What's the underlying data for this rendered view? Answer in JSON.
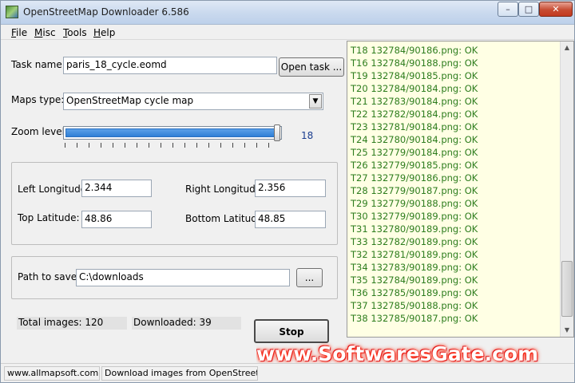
{
  "window": {
    "title": "OpenStreetMap Downloader 6.586",
    "minimize_glyph": "–",
    "maximize_glyph": "□",
    "close_glyph": "✕"
  },
  "menu": {
    "items": [
      {
        "key": "F",
        "rest": "ile"
      },
      {
        "key": "M",
        "rest": "isc"
      },
      {
        "key": "T",
        "rest": "ools"
      },
      {
        "key": "H",
        "rest": "elp"
      }
    ]
  },
  "task": {
    "label": "Task name:",
    "value": "paris_18_cycle.eomd",
    "open_button": "Open task ..."
  },
  "maps": {
    "label": "Maps type:",
    "value": "OpenStreetMap cycle map",
    "arrow_glyph": "▼"
  },
  "zoom": {
    "label": "Zoom level:",
    "value": "18",
    "level_fraction": 1.0
  },
  "coords": {
    "left_longitude_label": "Left Longitude:",
    "left_longitude": "2.344",
    "right_longitude_label": "Right Longitude:",
    "right_longitude": "2.356",
    "top_latitude_label": "Top Latitude:",
    "top_latitude": "48.86",
    "bottom_latitude_label": "Bottom Latitude:",
    "bottom_latitude": "48.85"
  },
  "path": {
    "label": "Path to save:",
    "value": "C:\\downloads",
    "browse_button": "..."
  },
  "progress": {
    "total_images": "Total images: 120",
    "downloaded": "Downloaded: 39",
    "stop_button": "Stop"
  },
  "log": {
    "lines": [
      "T18 132784/90186.png: OK",
      "T16 132784/90188.png: OK",
      "T19 132784/90185.png: OK",
      "T20 132784/90184.png: OK",
      "T21 132783/90184.png: OK",
      "T22 132782/90184.png: OK",
      "T23 132781/90184.png: OK",
      "T24 132780/90184.png: OK",
      "T25 132779/90184.png: OK",
      "T26 132779/90185.png: OK",
      "T27 132779/90186.png: OK",
      "T28 132779/90187.png: OK",
      "T29 132779/90188.png: OK",
      "T30 132779/90189.png: OK",
      "T31 132780/90189.png: OK",
      "T33 132782/90189.png: OK",
      "T32 132781/90189.png: OK",
      "T34 132783/90189.png: OK",
      "T35 132784/90189.png: OK",
      "T36 132785/90189.png: OK",
      "T37 132785/90188.png: OK",
      "T38 132785/90187.png: OK"
    ],
    "scroll_up_glyph": "▲",
    "scroll_down_glyph": "▼"
  },
  "watermark": "www.SoftwaresGate.com",
  "statusbar": {
    "site": "www.allmapsoft.com",
    "message": "Download images from OpenStreetMap"
  },
  "colors": {
    "log_text": "#2e7d1e",
    "log_background": "#ffffe4",
    "zoom_fill": "#2f7fd6",
    "zoom_value": "#1a3d8f"
  }
}
